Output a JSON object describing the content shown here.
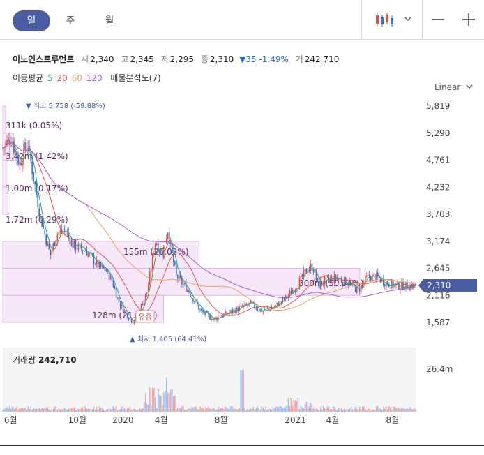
{
  "tabs": {
    "day": "일",
    "week": "주",
    "month": "월"
  },
  "stock": {
    "name": "이노인스트루먼트",
    "open_label": "시",
    "open": "2,340",
    "high_label": "고",
    "high": "2,345",
    "low_label": "저",
    "low": "2,295",
    "close_label": "종",
    "close": "2,310",
    "change": "▼35 -1.49%",
    "volume_label": "거",
    "volume": "242,710"
  },
  "ma": {
    "label": "이동평균",
    "p5": "5",
    "p20": "20",
    "p60": "60",
    "p120": "120",
    "profile": "매물분석도(7)"
  },
  "scale_label": "Linear",
  "volume_panel": {
    "label": "거래량",
    "value": "242,710",
    "axis_max": "26.4m"
  },
  "colors": {
    "up": "#e0504b",
    "down": "#2f6fd6",
    "ma5": "#3aa05a",
    "ma20": "#e0504b",
    "ma60": "#f0a060",
    "ma120": "#a259e0",
    "price_tag": "#4a5da2",
    "profile_fill": "#f6e6f8",
    "profile_stroke": "#d9b3e0"
  },
  "chart_data": {
    "type": "candlestick",
    "y_ticks": [
      "5,819",
      "5,290",
      "4,761",
      "4,232",
      "3,703",
      "3,174",
      "2,645",
      "2,116",
      "1,587"
    ],
    "x_ticks": [
      "6월",
      "10월",
      "2020",
      "4월",
      "8월",
      "2021",
      "4월",
      "8월"
    ],
    "current_price": "2,310",
    "high_marker": "최고 5,758 (-59.88%)",
    "low_marker": "최저 1,405 (64.41%)",
    "event_badge": "유증",
    "volume_profile": [
      {
        "label": "311k (0.05%)",
        "width": 0.004
      },
      {
        "label": "3.42m (1.42%)",
        "width": 0.03
      },
      {
        "label": "1.00m (0.17%)",
        "width": 0.01
      },
      {
        "label": "1.72m (0.29%)",
        "width": 0.015
      },
      {
        "label": "155m (26.02%)",
        "width": 0.55
      },
      {
        "label": "300m (50.34%)",
        "width": 1.0
      },
      {
        "label": "128m (21.54%)",
        "width": 0.45
      }
    ],
    "price_path": [
      [
        0,
        5000
      ],
      [
        0.02,
        5200
      ],
      [
        0.04,
        4700
      ],
      [
        0.06,
        5100
      ],
      [
        0.075,
        4400
      ],
      [
        0.09,
        3700
      ],
      [
        0.105,
        3200
      ],
      [
        0.115,
        2900
      ],
      [
        0.13,
        3300
      ],
      [
        0.15,
        3400
      ],
      [
        0.17,
        3100
      ],
      [
        0.2,
        3000
      ],
      [
        0.23,
        2700
      ],
      [
        0.25,
        2600
      ],
      [
        0.265,
        2400
      ],
      [
        0.28,
        2000
      ],
      [
        0.3,
        1750
      ],
      [
        0.315,
        1600
      ],
      [
        0.33,
        1800
      ],
      [
        0.35,
        2200
      ],
      [
        0.37,
        3200
      ],
      [
        0.385,
        2900
      ],
      [
        0.4,
        3400
      ],
      [
        0.41,
        2900
      ],
      [
        0.42,
        2500
      ],
      [
        0.45,
        2200
      ],
      [
        0.48,
        1800
      ],
      [
        0.51,
        1650
      ],
      [
        0.54,
        1750
      ],
      [
        0.57,
        1850
      ],
      [
        0.6,
        1950
      ],
      [
        0.63,
        1800
      ],
      [
        0.66,
        1900
      ],
      [
        0.69,
        2100
      ],
      [
        0.72,
        2400
      ],
      [
        0.735,
        2600
      ],
      [
        0.75,
        2700
      ],
      [
        0.765,
        2300
      ],
      [
        0.78,
        2400
      ],
      [
        0.81,
        2450
      ],
      [
        0.84,
        2350
      ],
      [
        0.86,
        2200
      ],
      [
        0.88,
        2450
      ],
      [
        0.9,
        2500
      ],
      [
        0.93,
        2350
      ],
      [
        0.96,
        2300
      ],
      [
        1.0,
        2310
      ]
    ]
  }
}
